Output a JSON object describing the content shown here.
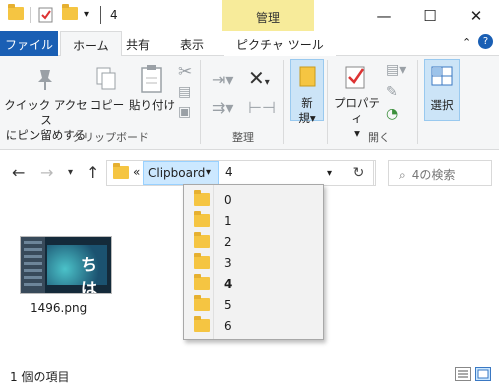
{
  "window": {
    "title": "4",
    "context_tab_group": "管理",
    "minimize": "—",
    "maximize": "☐",
    "close": "✕"
  },
  "ribbon_tabs": {
    "file": "ファイル",
    "home": "ホーム",
    "share": "共有",
    "view": "表示",
    "picture_tools": "ピクチャ ツール"
  },
  "ribbon": {
    "pin_label_line1": "クイック アクセス",
    "pin_label_line2": "にピン留めする",
    "copy_label": "コピー",
    "paste_label": "貼り付け",
    "clipboard_group": "クリップボード",
    "organize_group": "整理",
    "new_label_line1": "新",
    "new_label_line2": "規",
    "properties_label": "プロパティ",
    "open_group": "開く",
    "select_label": "選択"
  },
  "address": {
    "overflow": "«",
    "crumb_parent": "Clipboard",
    "crumb_current": "4",
    "search_placeholder": "4の検索"
  },
  "dropdown": {
    "items": [
      "0",
      "1",
      "2",
      "3",
      "4",
      "5",
      "6"
    ],
    "bold_item": "4"
  },
  "files": [
    {
      "name": "1496.png",
      "thumb_text": "ちは"
    }
  ],
  "status": {
    "item_count": "1 個の項目"
  },
  "colors": {
    "accent": "#1a5fb4",
    "context_tab": "#f7eb9a",
    "selection": "#cce8ff",
    "folder": "#f5c542"
  }
}
